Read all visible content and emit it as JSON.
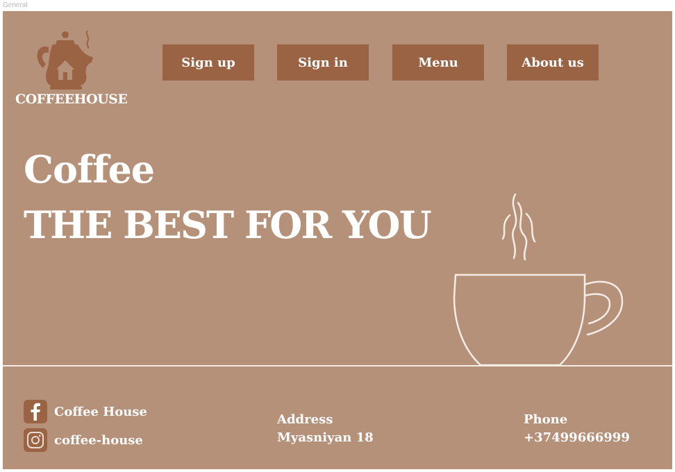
{
  "frame": {
    "label": "General"
  },
  "brand": {
    "name": "COFFEEHOUSE"
  },
  "nav": {
    "sign_up": "Sign up",
    "sign_in": "Sign in",
    "menu": "Menu",
    "about": "About us"
  },
  "hero": {
    "title": "Coffee",
    "tagline": "THE BEST FOR YOU"
  },
  "footer": {
    "facebook": "Coffee House",
    "instagram": "coffee-house",
    "address_label": "Address",
    "address_value": "Myasniyan 18",
    "phone_label": "Phone",
    "phone_value": "+37499666999"
  },
  "icons": {
    "logo": "coffeepot-house-icon",
    "facebook": "facebook-icon",
    "instagram": "instagram-icon",
    "cup": "steaming-cup-illustration"
  },
  "colors": {
    "background": "#b69179",
    "button": "#9a6444",
    "text": "#ffffff"
  }
}
